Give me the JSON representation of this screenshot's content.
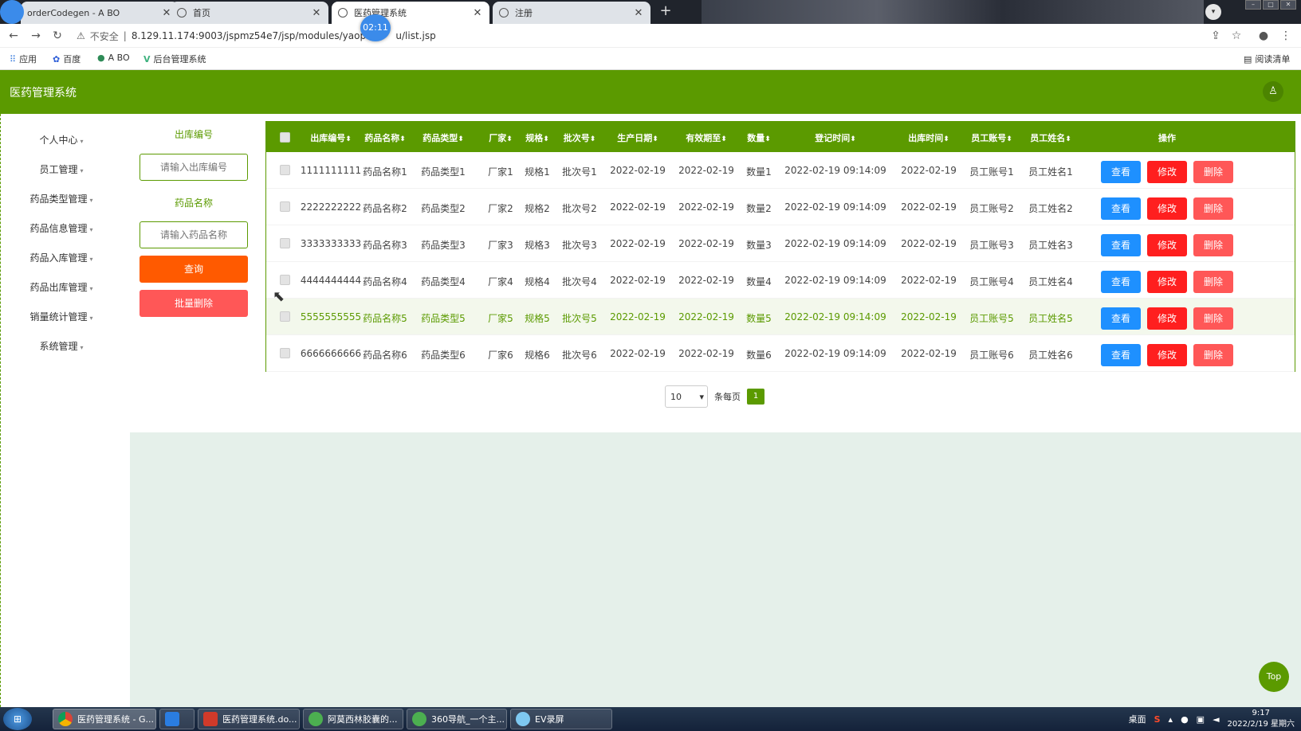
{
  "browser": {
    "tabs": [
      {
        "title": "orderCodegen - A BO"
      },
      {
        "title": "首页"
      },
      {
        "title": "医药管理系统"
      },
      {
        "title": "注册"
      }
    ],
    "close_glyph": "✕",
    "new_tab_glyph": "+",
    "recording_badge": "02:11",
    "insecure_label": "不安全",
    "url": "8.129.11.174:9003/jspmz54e7/jsp/modules/yaopi",
    "url_tail": "u/list.jsp",
    "bookmarks": [
      {
        "label": "应用"
      },
      {
        "label": "百度"
      },
      {
        "label": "A BO"
      },
      {
        "label": "后台管理系统"
      }
    ],
    "reading_list": "阅读清单"
  },
  "app": {
    "title": "医药管理系统",
    "sidebar": [
      {
        "label": "个人中心"
      },
      {
        "label": "员工管理"
      },
      {
        "label": "药品类型管理"
      },
      {
        "label": "药品信息管理"
      },
      {
        "label": "药品入库管理"
      },
      {
        "label": "药品出库管理"
      },
      {
        "label": "销量统计管理"
      },
      {
        "label": "系统管理"
      }
    ],
    "filters": {
      "code_label": "出库编号",
      "code_placeholder": "请输入出库编号",
      "name_label": "药品名称",
      "name_placeholder": "请输入药品名称",
      "search_button": "查询",
      "batch_delete_button": "批量删除"
    },
    "table": {
      "headers": [
        "出库编号",
        "药品名称",
        "药品类型",
        "厂家",
        "规格",
        "批次号",
        "生产日期",
        "有效期至",
        "数量",
        "登记时间",
        "出库时间",
        "员工账号",
        "员工姓名",
        "操作"
      ],
      "rows": [
        [
          "1111111111",
          "药品名称1",
          "药品类型1",
          "厂家1",
          "规格1",
          "批次号1",
          "2022-02-19",
          "2022-02-19",
          "数量1",
          "2022-02-19 09:14:09",
          "2022-02-19",
          "员工账号1",
          "员工姓名1"
        ],
        [
          "2222222222",
          "药品名称2",
          "药品类型2",
          "厂家2",
          "规格2",
          "批次号2",
          "2022-02-19",
          "2022-02-19",
          "数量2",
          "2022-02-19 09:14:09",
          "2022-02-19",
          "员工账号2",
          "员工姓名2"
        ],
        [
          "3333333333",
          "药品名称3",
          "药品类型3",
          "厂家3",
          "规格3",
          "批次号3",
          "2022-02-19",
          "2022-02-19",
          "数量3",
          "2022-02-19 09:14:09",
          "2022-02-19",
          "员工账号3",
          "员工姓名3"
        ],
        [
          "4444444444",
          "药品名称4",
          "药品类型4",
          "厂家4",
          "规格4",
          "批次号4",
          "2022-02-19",
          "2022-02-19",
          "数量4",
          "2022-02-19 09:14:09",
          "2022-02-19",
          "员工账号4",
          "员工姓名4"
        ],
        [
          "5555555555",
          "药品名称5",
          "药品类型5",
          "厂家5",
          "规格5",
          "批次号5",
          "2022-02-19",
          "2022-02-19",
          "数量5",
          "2022-02-19 09:14:09",
          "2022-02-19",
          "员工账号5",
          "员工姓名5"
        ],
        [
          "6666666666",
          "药品名称6",
          "药品类型6",
          "厂家6",
          "规格6",
          "批次号6",
          "2022-02-19",
          "2022-02-19",
          "数量6",
          "2022-02-19 09:14:09",
          "2022-02-19",
          "员工账号6",
          "员工姓名6"
        ]
      ],
      "highlighted_row": 4,
      "actions": {
        "view": "查看",
        "edit": "修改",
        "delete": "删除"
      },
      "sort_glyph": "⬍"
    },
    "pager": {
      "page_size": "10",
      "per_page_label": "条每页",
      "current_page": "1"
    },
    "top_button": "Top",
    "colors": {
      "primary": "#5b9a00",
      "view": "#1e90ff",
      "edit": "#ff1f1f",
      "delete": "#ff5757",
      "search": "#ff5a00"
    }
  },
  "taskbar": {
    "items": [
      {
        "label": "医药管理系统 - G..."
      },
      {
        "label": ""
      },
      {
        "label": "医药管理系统.do..."
      },
      {
        "label": "阿莫西林胶囊的..."
      },
      {
        "label": "360导航_一个主..."
      },
      {
        "label": "EV录屏"
      }
    ],
    "desktop_label": "桌面",
    "time": "9:17",
    "date": "2022/2/19 星期六"
  }
}
